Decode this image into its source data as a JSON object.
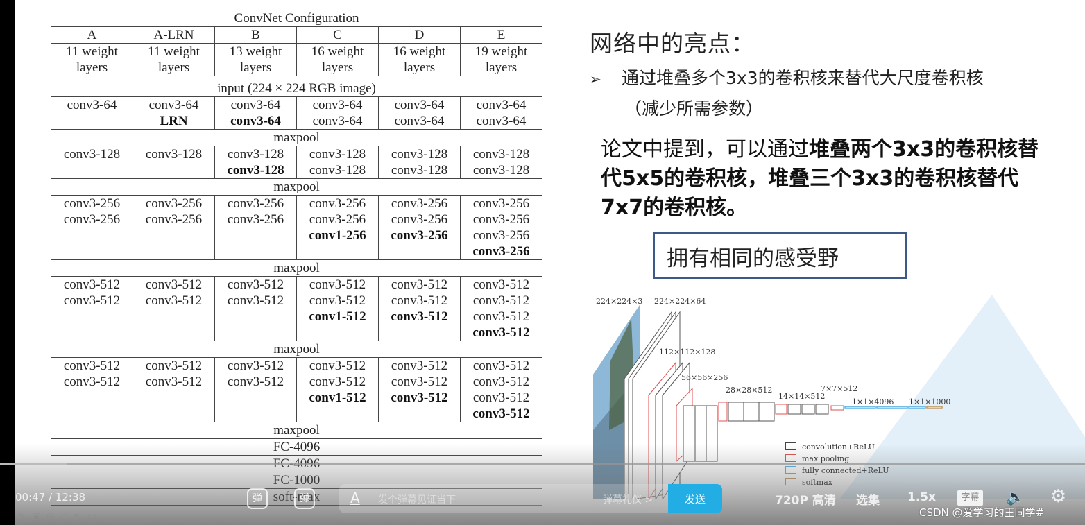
{
  "table": {
    "title": "ConvNet Configuration",
    "configs": [
      "A",
      "A-LRN",
      "B",
      "C",
      "D",
      "E"
    ],
    "weight_layers": [
      "11 weight layers",
      "11 weight layers",
      "13 weight layers",
      "16 weight layers",
      "16 weight layers",
      "19 weight layers"
    ],
    "input": "input (224 × 224 RGB image)",
    "blocks": [
      {
        "cells": [
          [
            {
              "t": "conv3-64",
              "b": false
            }
          ],
          [
            {
              "t": "conv3-64",
              "b": false
            },
            {
              "t": "LRN",
              "b": true
            }
          ],
          [
            {
              "t": "conv3-64",
              "b": false
            },
            {
              "t": "conv3-64",
              "b": true
            }
          ],
          [
            {
              "t": "conv3-64",
              "b": false
            },
            {
              "t": "conv3-64",
              "b": false
            }
          ],
          [
            {
              "t": "conv3-64",
              "b": false
            },
            {
              "t": "conv3-64",
              "b": false
            }
          ],
          [
            {
              "t": "conv3-64",
              "b": false
            },
            {
              "t": "conv3-64",
              "b": false
            }
          ]
        ]
      },
      {
        "cells": [
          [
            {
              "t": "conv3-128",
              "b": false
            }
          ],
          [
            {
              "t": "conv3-128",
              "b": false
            }
          ],
          [
            {
              "t": "conv3-128",
              "b": false
            },
            {
              "t": "conv3-128",
              "b": true
            }
          ],
          [
            {
              "t": "conv3-128",
              "b": false
            },
            {
              "t": "conv3-128",
              "b": false
            }
          ],
          [
            {
              "t": "conv3-128",
              "b": false
            },
            {
              "t": "conv3-128",
              "b": false
            }
          ],
          [
            {
              "t": "conv3-128",
              "b": false
            },
            {
              "t": "conv3-128",
              "b": false
            }
          ]
        ]
      },
      {
        "cells": [
          [
            {
              "t": "conv3-256",
              "b": false
            },
            {
              "t": "conv3-256",
              "b": false
            }
          ],
          [
            {
              "t": "conv3-256",
              "b": false
            },
            {
              "t": "conv3-256",
              "b": false
            }
          ],
          [
            {
              "t": "conv3-256",
              "b": false
            },
            {
              "t": "conv3-256",
              "b": false
            }
          ],
          [
            {
              "t": "conv3-256",
              "b": false
            },
            {
              "t": "conv3-256",
              "b": false
            },
            {
              "t": "conv1-256",
              "b": true
            }
          ],
          [
            {
              "t": "conv3-256",
              "b": false
            },
            {
              "t": "conv3-256",
              "b": false
            },
            {
              "t": "conv3-256",
              "b": true
            }
          ],
          [
            {
              "t": "conv3-256",
              "b": false
            },
            {
              "t": "conv3-256",
              "b": false
            },
            {
              "t": "conv3-256",
              "b": false
            },
            {
              "t": "conv3-256",
              "b": true
            }
          ]
        ]
      },
      {
        "cells": [
          [
            {
              "t": "conv3-512",
              "b": false
            },
            {
              "t": "conv3-512",
              "b": false
            }
          ],
          [
            {
              "t": "conv3-512",
              "b": false
            },
            {
              "t": "conv3-512",
              "b": false
            }
          ],
          [
            {
              "t": "conv3-512",
              "b": false
            },
            {
              "t": "conv3-512",
              "b": false
            }
          ],
          [
            {
              "t": "conv3-512",
              "b": false
            },
            {
              "t": "conv3-512",
              "b": false
            },
            {
              "t": "conv1-512",
              "b": true
            }
          ],
          [
            {
              "t": "conv3-512",
              "b": false
            },
            {
              "t": "conv3-512",
              "b": false
            },
            {
              "t": "conv3-512",
              "b": true
            }
          ],
          [
            {
              "t": "conv3-512",
              "b": false
            },
            {
              "t": "conv3-512",
              "b": false
            },
            {
              "t": "conv3-512",
              "b": false
            },
            {
              "t": "conv3-512",
              "b": true
            }
          ]
        ]
      },
      {
        "cells": [
          [
            {
              "t": "conv3-512",
              "b": false
            },
            {
              "t": "conv3-512",
              "b": false
            }
          ],
          [
            {
              "t": "conv3-512",
              "b": false
            },
            {
              "t": "conv3-512",
              "b": false
            }
          ],
          [
            {
              "t": "conv3-512",
              "b": false
            },
            {
              "t": "conv3-512",
              "b": false
            }
          ],
          [
            {
              "t": "conv3-512",
              "b": false
            },
            {
              "t": "conv3-512",
              "b": false
            },
            {
              "t": "conv1-512",
              "b": true
            }
          ],
          [
            {
              "t": "conv3-512",
              "b": false
            },
            {
              "t": "conv3-512",
              "b": false
            },
            {
              "t": "conv3-512",
              "b": true
            }
          ],
          [
            {
              "t": "conv3-512",
              "b": false
            },
            {
              "t": "conv3-512",
              "b": false
            },
            {
              "t": "conv3-512",
              "b": false
            },
            {
              "t": "conv3-512",
              "b": true
            }
          ]
        ]
      }
    ],
    "maxpool": "maxpool",
    "tail": [
      "maxpool",
      "FC-4096",
      "FC-4096",
      "FC-1000",
      "soft-max"
    ]
  },
  "slide": {
    "title": "网络中的亮点：",
    "bullet_marker": "➢",
    "bullet": "通过堆叠多个3x3的卷积核来替代大尺度卷积核",
    "bullet_sub": "（减少所需参数）",
    "paper_note": [
      {
        "t": "论文中提到，可以通过",
        "b": false
      },
      {
        "t": "堆叠两个3x3的卷积核替代5x5的卷积核，堆叠三个3x3的卷积核替代7x7的卷积核。",
        "b": true
      }
    ],
    "receptive_field_box": "拥有相同的感受野"
  },
  "diagram": {
    "labels": [
      "224×224×3",
      "224×224×64",
      "112×112×128",
      "56×56×256",
      "28×28×512",
      "14×14×512",
      "7×7×512",
      "1×1×4096",
      "1×1×1000"
    ],
    "legend": [
      {
        "label": "convolution+ReLU",
        "color": "#444444"
      },
      {
        "label": "max pooling",
        "color": "#e05050"
      },
      {
        "label": "fully connected+ReLU",
        "color": "#5ab0e0"
      },
      {
        "label": "softmax",
        "color": "#c09a6a"
      }
    ]
  },
  "player": {
    "current_time": "00:47",
    "duration": "12:38",
    "progress_fraction": 0.062,
    "danmaku_off_icon": "弹",
    "danmaku_settings_icon": "弹",
    "danmaku_placeholder": "发个弹幕见证当下",
    "danmaku_etiquette": "弹幕礼仪 >",
    "send_label": "发送",
    "quality": "720P 高清",
    "episodes": "选集",
    "speed": "1.5x",
    "subtitle_icon": "字幕",
    "accent_color": "#23ade5",
    "watermark": "CSDN @爱学习的王同学#"
  }
}
